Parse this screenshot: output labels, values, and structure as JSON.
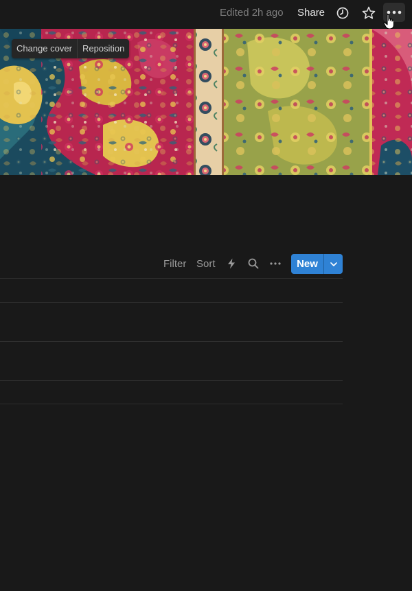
{
  "topbar": {
    "edited_text": "Edited 2h ago",
    "share_label": "Share",
    "updates_icon": "clock-icon",
    "favorite_icon": "star-icon",
    "more_icon": "more-horizontal-icon"
  },
  "cover": {
    "change_cover_label": "Change cover",
    "reposition_label": "Reposition"
  },
  "database": {
    "filter_label": "Filter",
    "sort_label": "Sort",
    "automation_icon": "lightning-icon",
    "search_icon": "search-icon",
    "more_icon": "more-horizontal-icon",
    "new_label": "New",
    "new_dropdown_icon": "chevron-down-icon"
  },
  "colors": {
    "background": "#191919",
    "accent": "#2f82d5"
  }
}
